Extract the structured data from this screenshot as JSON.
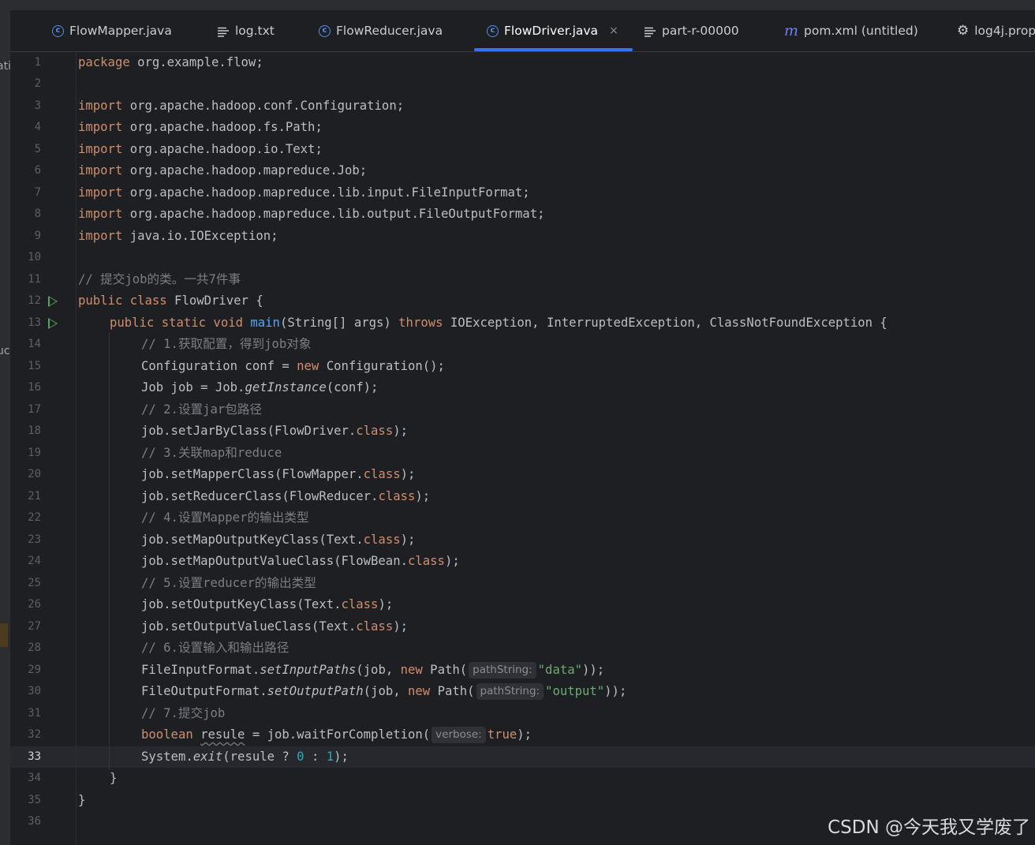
{
  "tabs": [
    {
      "label": "FlowMapper.java",
      "icon": "java-class-icon"
    },
    {
      "label": "log.txt",
      "icon": "text-file-icon"
    },
    {
      "label": "FlowReducer.java",
      "icon": "java-class-icon"
    },
    {
      "label": "FlowDriver.java",
      "icon": "java-class-icon",
      "active": true,
      "close": "×"
    },
    {
      "label": "part-r-00000",
      "icon": "text-file-icon"
    },
    {
      "label": "pom.xml (untitled)",
      "icon": "maven-icon"
    },
    {
      "label": "log4j.prop",
      "icon": "gear-icon"
    }
  ],
  "side_fragments": [
    "ati",
    "uc"
  ],
  "line_numbers": [
    "1",
    "2",
    "3",
    "4",
    "5",
    "6",
    "7",
    "8",
    "9",
    "10",
    "11",
    "12",
    "13",
    "14",
    "15",
    "16",
    "17",
    "18",
    "19",
    "20",
    "21",
    "22",
    "23",
    "24",
    "25",
    "26",
    "27",
    "28",
    "29",
    "30",
    "31",
    "32",
    "33",
    "34",
    "35",
    "36"
  ],
  "current_line": "33",
  "run_icon_lines": [
    "12",
    "13"
  ],
  "code": {
    "l1": [
      "package",
      " org.example.flow;"
    ],
    "l3": [
      "import",
      " org.apache.hadoop.conf.Configuration;"
    ],
    "l4": [
      "import",
      " org.apache.hadoop.fs.Path;"
    ],
    "l5": [
      "import",
      " org.apache.hadoop.io.Text;"
    ],
    "l6": [
      "import",
      " org.apache.hadoop.mapreduce.Job;"
    ],
    "l7": [
      "import",
      " org.apache.hadoop.mapreduce.lib.input.FileInputFormat;"
    ],
    "l8": [
      "import",
      " org.apache.hadoop.mapreduce.lib.output.FileOutputFormat;"
    ],
    "l9": [
      "import",
      " java.io.IOException;"
    ],
    "l11": "// 提交job的类。一共7件事",
    "l12": [
      "public class",
      " FlowDriver {"
    ],
    "l13": [
      "public static void",
      " ",
      "main",
      "(String[] args) ",
      "throws",
      " IOException, InterruptedException, ClassNotFoundException {"
    ],
    "l14": "// 1.获取配置，得到job对象",
    "l15": [
      "Configuration conf = ",
      "new",
      " Configuration();"
    ],
    "l16": [
      "Job job = Job.",
      "getInstance",
      "(conf);"
    ],
    "l17": "// 2.设置jar包路径",
    "l18": [
      "job.setJarByClass(FlowDriver.",
      "class",
      ");"
    ],
    "l19": "// 3.关联map和reduce",
    "l20": [
      "job.setMapperClass(FlowMapper.",
      "class",
      ");"
    ],
    "l21": [
      "job.setReducerClass(FlowReducer.",
      "class",
      ");"
    ],
    "l22": "// 4.设置Mapper的输出类型",
    "l23": [
      "job.setMapOutputKeyClass(Text.",
      "class",
      ");"
    ],
    "l24": [
      "job.setMapOutputValueClass(FlowBean.",
      "class",
      ");"
    ],
    "l25": "// 5.设置reducer的输出类型",
    "l26": [
      "job.setOutputKeyClass(Text.",
      "class",
      ");"
    ],
    "l27": [
      "job.setOutputValueClass(Text.",
      "class",
      ");"
    ],
    "l28": "// 6.设置输入和输出路径",
    "l29": [
      "FileInputFormat.",
      "setInputPaths",
      "(job, ",
      "new",
      " Path(",
      "pathString:",
      "\"data\"",
      "));"
    ],
    "l30": [
      "FileOutputFormat.",
      "setOutputPath",
      "(job, ",
      "new",
      " Path(",
      "pathString:",
      "\"output\"",
      "));"
    ],
    "l31": "// 7.提交job",
    "l32": [
      "boolean",
      " ",
      "resule",
      " = job.waitForCompletion(",
      "verbose:",
      "true",
      ");"
    ],
    "l33": [
      "System.",
      "exit",
      "(resule ? ",
      "0",
      " : ",
      "1",
      ");"
    ],
    "l34": "}",
    "l35": "}"
  },
  "watermark": "CSDN @今天我又学废了"
}
